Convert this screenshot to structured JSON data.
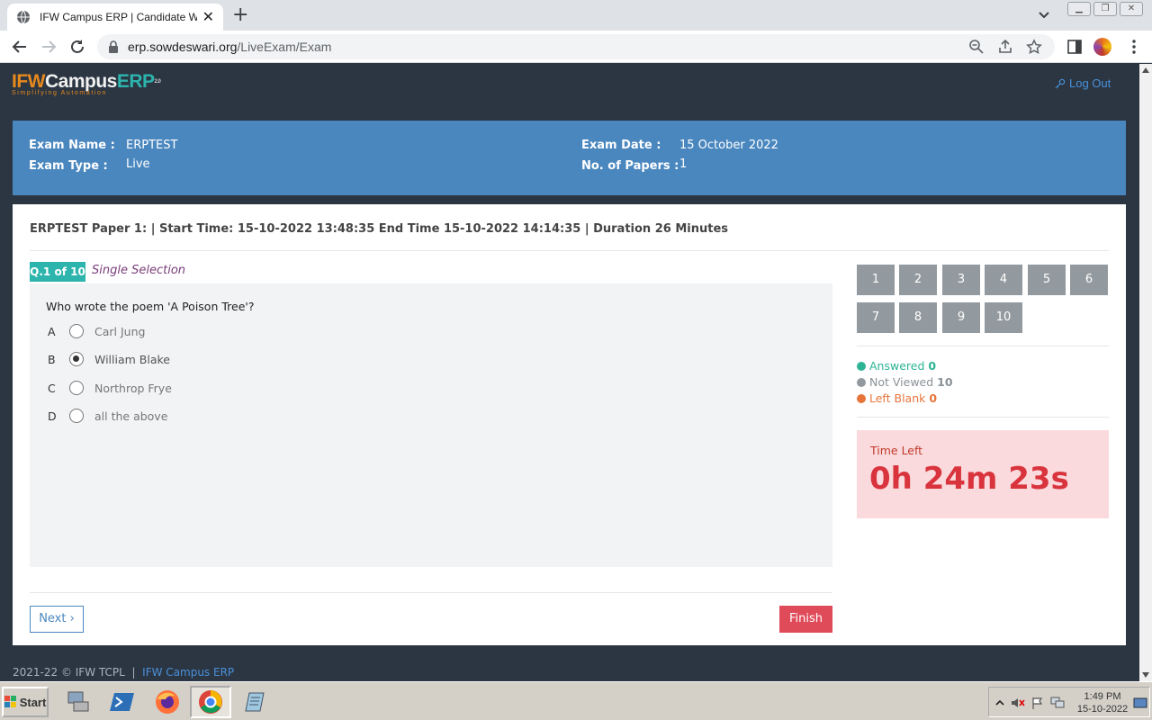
{
  "browser": {
    "tab_title": "IFW Campus ERP | Candidate Welcome",
    "url_host": "erp.sowdeswari.org",
    "url_path": "/LiveExam/Exam"
  },
  "header": {
    "logo_ifw": "IFW",
    "logo_campus": "Campus",
    "logo_erp": "ERP",
    "logo_version": "2.0",
    "logo_tagline": "Simplifying Automation",
    "logout_label": "Log Out"
  },
  "exam": {
    "name_label": "Exam Name :",
    "name_value": "ERPTEST",
    "type_label": "Exam Type :",
    "type_value": "Live",
    "date_label": "Exam Date :",
    "date_value": "15 October 2022",
    "papers_label": "No. of Papers :",
    "papers_value": "1"
  },
  "paper_line": "ERPTEST Paper 1: | Start Time: 15-10-2022 13:48:35 End Time 15-10-2022 14:14:35 | Duration 26 Minutes",
  "question": {
    "badge": "Q.1 of 10",
    "type": "Single Selection",
    "text": "Who wrote the poem 'A Poison Tree'?",
    "options": [
      {
        "letter": "A",
        "text": "Carl Jung",
        "selected": false
      },
      {
        "letter": "B",
        "text": "William Blake",
        "selected": true
      },
      {
        "letter": "C",
        "text": "Northrop Frye",
        "selected": false
      },
      {
        "letter": "D",
        "text": "all the above",
        "selected": false
      }
    ]
  },
  "buttons": {
    "next": "Next ›",
    "finish": "Finish"
  },
  "question_numbers": [
    "1",
    "2",
    "3",
    "4",
    "5",
    "6",
    "7",
    "8",
    "9",
    "10"
  ],
  "legend": {
    "answered_label": "Answered",
    "answered_count": "0",
    "answered_color": "#2cb495",
    "not_viewed_label": "Not Viewed",
    "not_viewed_count": "10",
    "not_viewed_color": "#939a9f",
    "left_blank_label": "Left Blank",
    "left_blank_count": "0",
    "left_blank_color": "#e8743b"
  },
  "timer": {
    "label": "Time Left",
    "value": "0h 24m 23s"
  },
  "footer": {
    "copyright": "2021-22 © IFW TCPL",
    "separator": "|",
    "link": "IFW Campus ERP"
  },
  "taskbar": {
    "start": "Start",
    "time": "1:49 PM",
    "date": "15-10-2022"
  }
}
